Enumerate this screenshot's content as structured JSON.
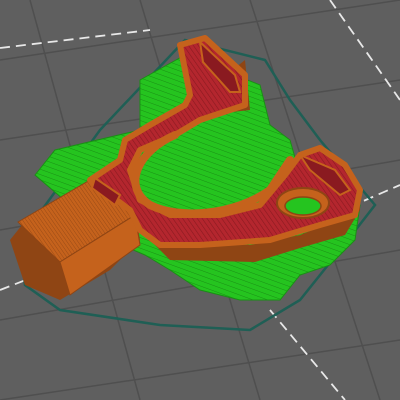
{
  "viewer": {
    "view": "3d-layer-preview",
    "colors": {
      "background": "#5f5f5f",
      "grid_line": "#4f4f4f",
      "dashed_guide": "#e8e8e8",
      "skirt": "#1f5f55",
      "support": "#25c41f",
      "support_dark": "#1a8f15",
      "perimeter": "#c5621c",
      "perimeter_dark": "#8f4514",
      "infill": "#b4262e",
      "infill_dark": "#8a1a20"
    },
    "layers": {
      "skirt_icon": "outline-loop",
      "support_icon": "support-material",
      "perimeter_icon": "outer-wall",
      "infill_icon": "solid-infill"
    }
  }
}
